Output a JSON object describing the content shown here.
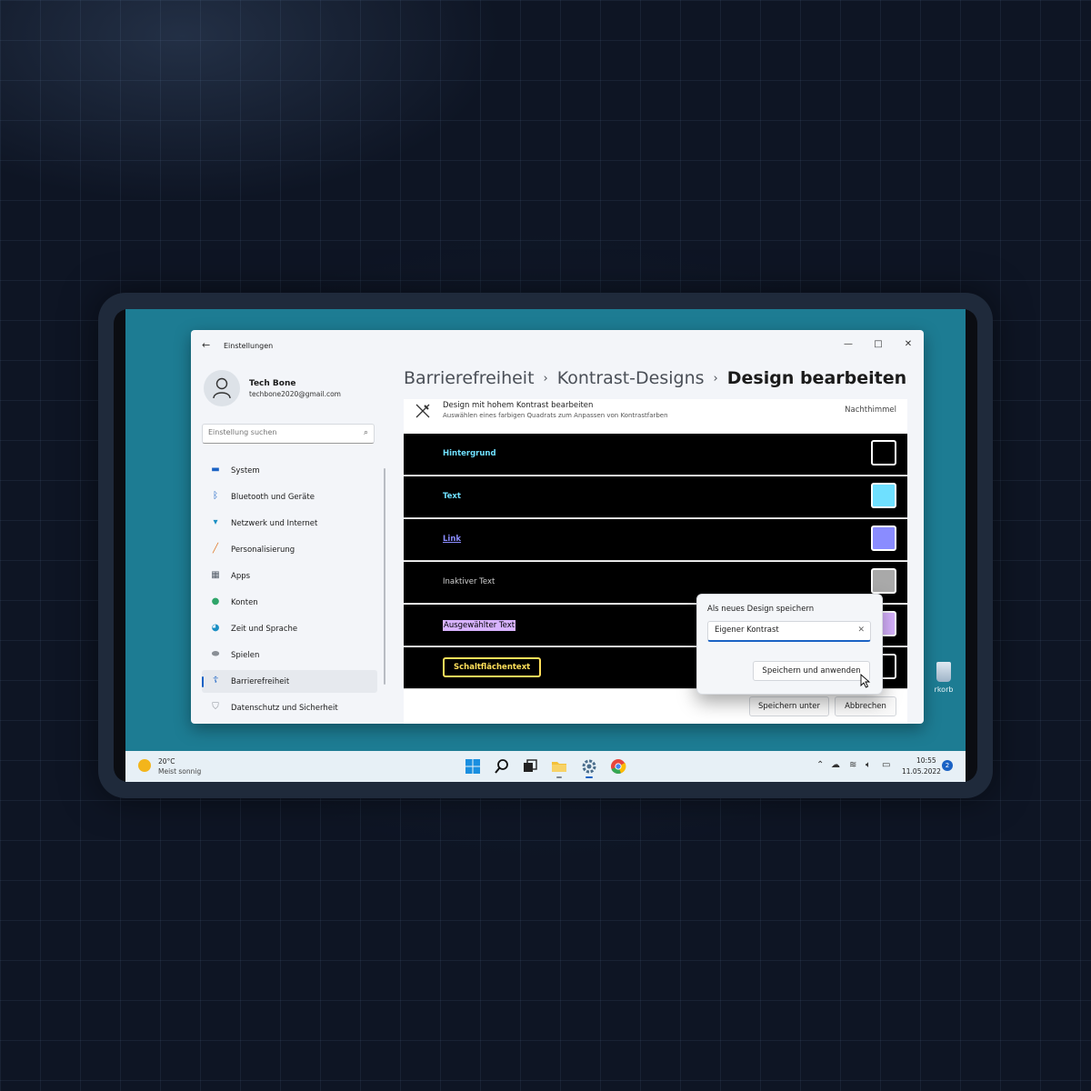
{
  "window": {
    "title": "Einstellungen",
    "controls": {
      "minimize": "—",
      "maximize": "□",
      "close": "✕"
    }
  },
  "user": {
    "name": "Tech Bone",
    "email": "techbone2020@gmail.com"
  },
  "search": {
    "placeholder": "Einstellung suchen"
  },
  "sidebar": {
    "items": [
      {
        "label": "System",
        "icon": "monitor-icon",
        "color": "#1a62c4"
      },
      {
        "label": "Bluetooth und Geräte",
        "icon": "bluetooth-icon",
        "color": "#1a62c4"
      },
      {
        "label": "Netzwerk und Internet",
        "icon": "wifi-icon",
        "color": "#1a62c4"
      },
      {
        "label": "Personalisierung",
        "icon": "brush-icon",
        "color": "#e07a2c"
      },
      {
        "label": "Apps",
        "icon": "apps-icon",
        "color": "#555e6a"
      },
      {
        "label": "Konten",
        "icon": "person-icon",
        "color": "#2fa56a"
      },
      {
        "label": "Zeit und Sprache",
        "icon": "globe-clock-icon",
        "color": "#1a8fc4"
      },
      {
        "label": "Spielen",
        "icon": "gamepad-icon",
        "color": "#8a8f96"
      },
      {
        "label": "Barrierefreiheit",
        "icon": "accessibility-icon",
        "color": "#1a62c4",
        "active": true
      },
      {
        "label": "Datenschutz und Sicherheit",
        "icon": "shield-icon",
        "color": "#8a8f96"
      }
    ]
  },
  "breadcrumb": {
    "items": [
      "Barrierefreiheit",
      "Kontrast-Designs",
      "Design bearbeiten"
    ],
    "separator": "›"
  },
  "panel": {
    "title": "Design mit hohem Kontrast bearbeiten",
    "subtitle": "Auswählen eines farbigen Quadrats zum Anpassen von Kontrastfarben",
    "theme_name": "Nachthimmel",
    "rows": [
      {
        "label": "Hintergrund",
        "swatch": "#000000"
      },
      {
        "label": "Text",
        "swatch": "#6fe0ff"
      },
      {
        "label": "Link",
        "swatch": "#8a8cff"
      },
      {
        "label": "Inaktiver Text",
        "swatch": "#a9a9a9"
      },
      {
        "label": "Ausgewählter Text",
        "swatch": "#d8b3ff"
      },
      {
        "label": "Schaltflächentext",
        "swatch": "#000000"
      }
    ],
    "save_as_label": "Speichern unter",
    "cancel_label": "Abbrechen"
  },
  "flyout": {
    "title": "Als neues Design speichern",
    "input_value": "Eigener Kontrast",
    "clear_glyph": "✕",
    "button_label": "Speichern und anwenden"
  },
  "desktop": {
    "recycle_label": "rkorb"
  },
  "taskbar": {
    "weather_temp": "20°C",
    "weather_desc": "Meist sonnig",
    "time": "10:55",
    "date": "11.05.2022",
    "notification_count": "2"
  },
  "colors": {
    "accent": "#1a62c4",
    "desktop": "#1d7c93",
    "link": "#8a8cff",
    "text_hc": "#6fe0ff",
    "button_hc": "#ffe05a"
  }
}
